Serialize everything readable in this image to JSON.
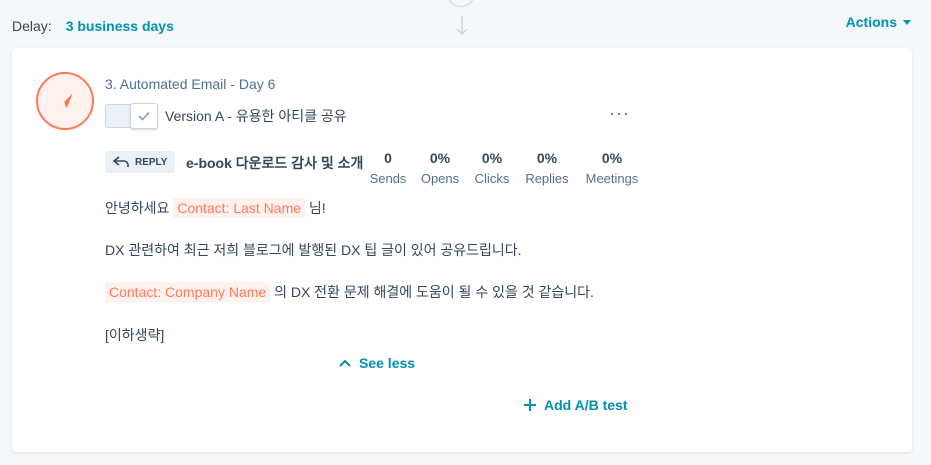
{
  "delay": {
    "label": "Delay:",
    "value": "3 business days"
  },
  "actions": {
    "label": "Actions"
  },
  "step": {
    "title": "3. Automated Email - Day 6",
    "version_label": "Version A - 유용한 아티클 공유",
    "reply_label": "REPLY",
    "subject": "e-book 다운로드 감사 및 소개",
    "more_label": "···"
  },
  "stats": [
    {
      "value": "0",
      "label": "Sends"
    },
    {
      "value": "0%",
      "label": "Opens"
    },
    {
      "value": "0%",
      "label": "Clicks"
    },
    {
      "value": "0%",
      "label": "Replies"
    },
    {
      "value": "0%",
      "label": "Meetings"
    }
  ],
  "email_body": {
    "line1_prefix": "안녕하세요",
    "line1_token": "Contact: Last Name",
    "line1_suffix": "님!",
    "line2": "DX 관련하여 최근 저희 블로그에 발행된 DX 팁 글이 있어 공유드립니다.",
    "line3_token": "Contact: Company Name",
    "line3_suffix": "의 DX 전환 문제 해결에 도움이 될 수 있을 것 같습니다.",
    "line4": "[이하생략]"
  },
  "see_less": {
    "label": "See less"
  },
  "add_ab": {
    "label": "Add A/B test"
  },
  "colors": {
    "accent": "#0091ae",
    "brand": "#ff7a59",
    "text": "#33475b"
  },
  "icons": {
    "step": "paper-plane-icon",
    "toggle": "check-icon",
    "reply": "reply-arrow-icon",
    "see_less": "chevron-up-icon",
    "add": "plus-icon",
    "actions": "caret-down-icon"
  }
}
